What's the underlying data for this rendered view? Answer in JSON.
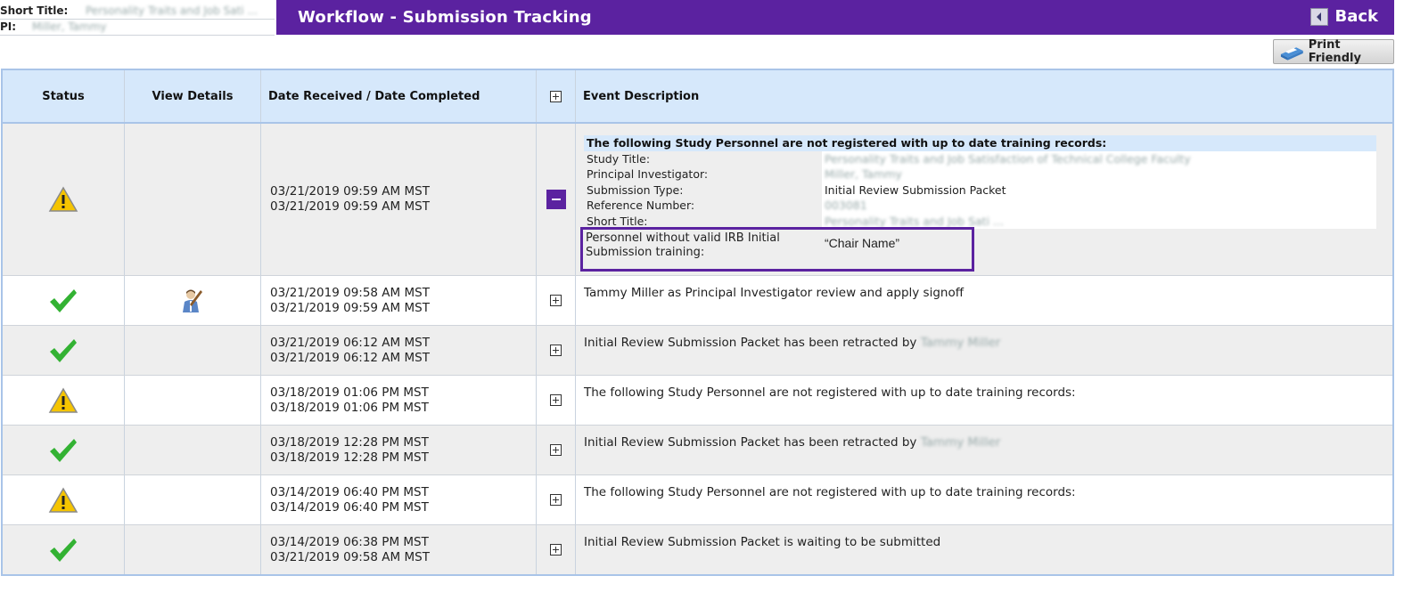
{
  "meta": {
    "short_title_label": "Short Title:",
    "short_title_value": "Personality Traits and Job Sati ...",
    "pi_label": "PI:",
    "pi_value": "Miller, Tammy"
  },
  "header": {
    "title": "Workflow - Submission Tracking",
    "back_label": "Back",
    "print_label": "Print Friendly"
  },
  "table": {
    "columns": [
      "Status",
      "View Details",
      "Date Received / Date Completed",
      "",
      "Event Description"
    ],
    "rows": [
      {
        "status": "warning-icon",
        "view_details": "",
        "date_received": "03/21/2019 09:59 AM MST",
        "date_completed": "03/21/2019 09:59 AM MST",
        "toggle": "minus",
        "expanded": true,
        "detail": {
          "heading": "The following Study Personnel are not registered with up to date training records:",
          "fields": [
            {
              "label": "Study Title:",
              "value": "Personality Traits and Job Satisfaction of Technical College Faculty",
              "blurred": true
            },
            {
              "label": "Principal Investigator:",
              "value": "Miller, Tammy",
              "blurred": true
            },
            {
              "label": "Submission Type:",
              "value": "Initial Review Submission Packet",
              "blurred": false
            },
            {
              "label": "Reference Number:",
              "value": "003081",
              "blurred": true
            },
            {
              "label": "Short Title:",
              "value": "Personality Traits and Job Sati ...",
              "blurred": true
            }
          ],
          "highlight_label": "Personnel without valid IRB Initial Submission training:",
          "highlight_value": "“Chair Name”"
        }
      },
      {
        "status": "check-icon",
        "view_details": "user-signoff-icon",
        "date_received": "03/21/2019 09:58 AM MST",
        "date_completed": "03/21/2019 09:59 AM MST",
        "toggle": "plus",
        "description": "Tammy Miller as Principal Investigator review and apply signoff"
      },
      {
        "status": "check-icon",
        "view_details": "",
        "date_received": "03/21/2019 06:12 AM MST",
        "date_completed": "03/21/2019 06:12 AM MST",
        "toggle": "plus",
        "description": "Initial Review Submission Packet has been retracted by",
        "description_blurred": "Tammy Miller"
      },
      {
        "status": "warning-icon",
        "view_details": "",
        "date_received": "03/18/2019 01:06 PM MST",
        "date_completed": "03/18/2019 01:06 PM MST",
        "toggle": "plus",
        "description": "The following Study Personnel are not registered with up to date training records:"
      },
      {
        "status": "check-icon",
        "view_details": "",
        "date_received": "03/18/2019 12:28 PM MST",
        "date_completed": "03/18/2019 12:28 PM MST",
        "toggle": "plus",
        "description": "Initial Review Submission Packet has been retracted by",
        "description_blurred": "Tammy Miller"
      },
      {
        "status": "warning-icon",
        "view_details": "",
        "date_received": "03/14/2019 06:40 PM MST",
        "date_completed": "03/14/2019 06:40 PM MST",
        "toggle": "plus",
        "description": "The following Study Personnel are not registered with up to date training records:"
      },
      {
        "status": "check-icon",
        "view_details": "",
        "date_received": "03/14/2019 06:38 PM MST",
        "date_completed": "03/21/2019 09:58 AM MST",
        "toggle": "plus",
        "description": "Initial Review Submission Packet is waiting to be submitted"
      }
    ]
  },
  "colors": {
    "brand_purple": "#5b22a0",
    "header_blue": "#d6e8fb",
    "check_green": "#33b233",
    "warning_yellow": "#f5c400"
  }
}
